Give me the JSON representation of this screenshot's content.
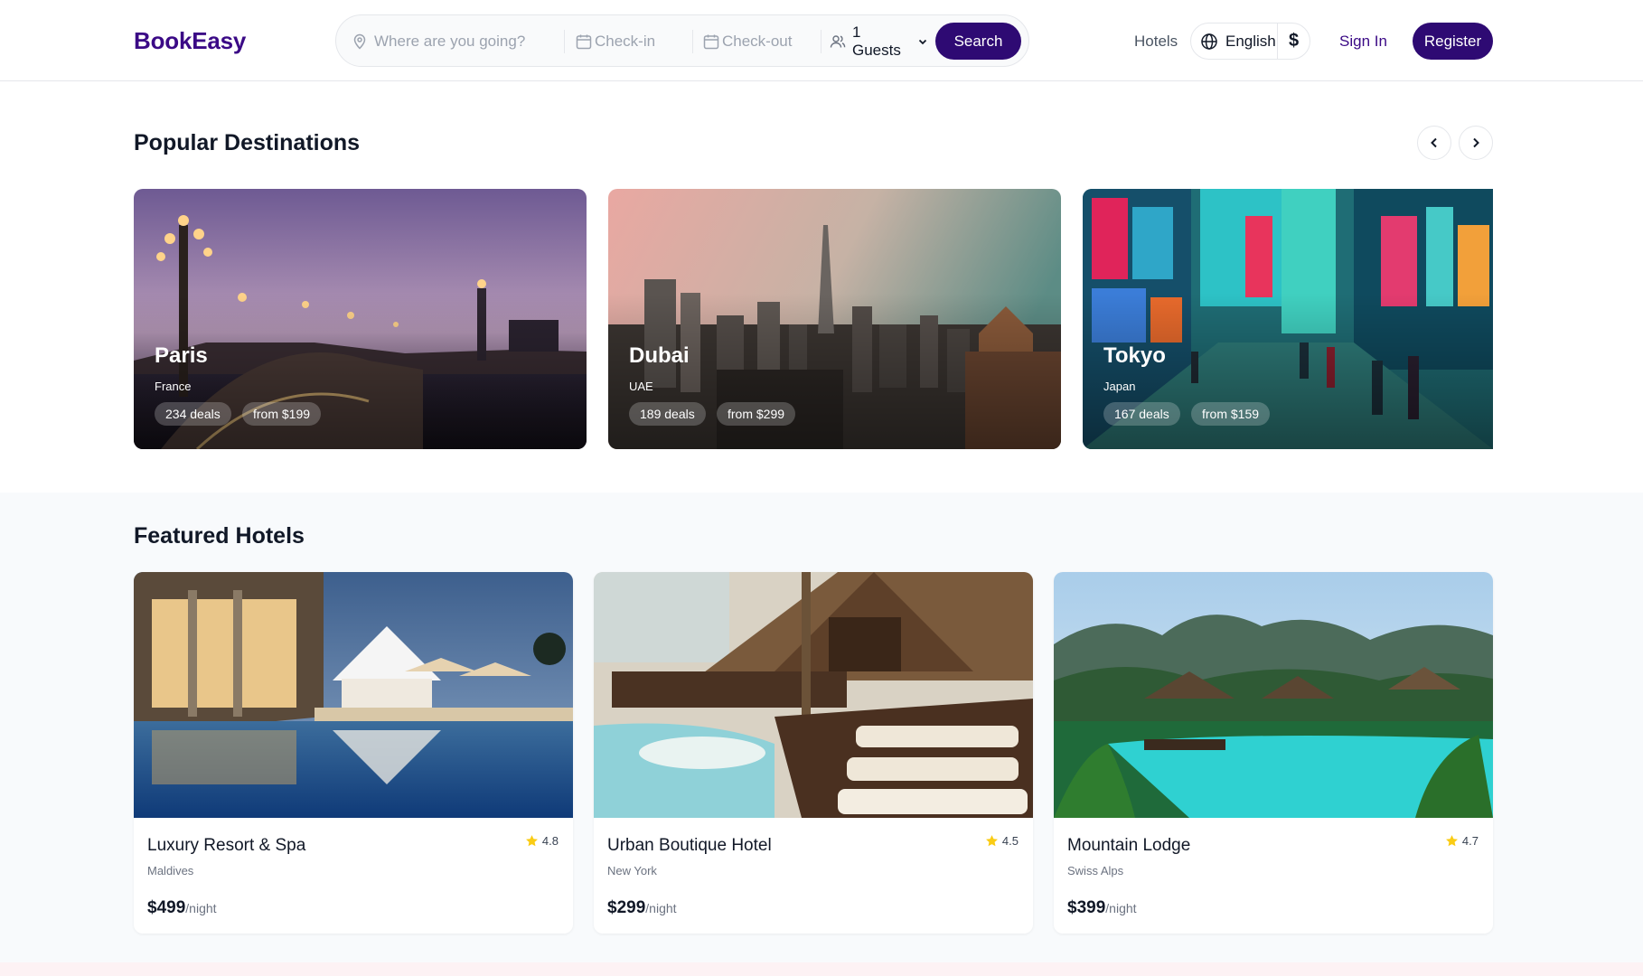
{
  "header": {
    "logo": "BookEasy",
    "search": {
      "destination_placeholder": "Where are you going?",
      "checkin_placeholder": "Check-in",
      "checkout_placeholder": "Check-out",
      "guests_value": "1 Guests",
      "button": "Search"
    },
    "nav_hotels": "Hotels",
    "language": "English",
    "currency_symbol": "$",
    "sign_in": "Sign In",
    "register": "Register"
  },
  "popular": {
    "title": "Popular Destinations",
    "destinations": [
      {
        "name": "Paris",
        "country": "France",
        "deals": "234 deals",
        "price": "from $199"
      },
      {
        "name": "Dubai",
        "country": "UAE",
        "deals": "189 deals",
        "price": "from $299"
      },
      {
        "name": "Tokyo",
        "country": "Japan",
        "deals": "167 deals",
        "price": "from $159"
      }
    ]
  },
  "featured": {
    "title": "Featured Hotels",
    "hotels": [
      {
        "name": "Luxury Resort & Spa",
        "location": "Maldives",
        "price": "$499",
        "unit": "/night",
        "rating": "4.8"
      },
      {
        "name": "Urban Boutique Hotel",
        "location": "New York",
        "price": "$299",
        "unit": "/night",
        "rating": "4.5"
      },
      {
        "name": "Mountain Lodge",
        "location": "Swiss Alps",
        "price": "$399",
        "unit": "/night",
        "rating": "4.7"
      }
    ]
  },
  "colors": {
    "brand": "#2e0a73",
    "logo": "#3b0a86",
    "star": "#facc15"
  }
}
